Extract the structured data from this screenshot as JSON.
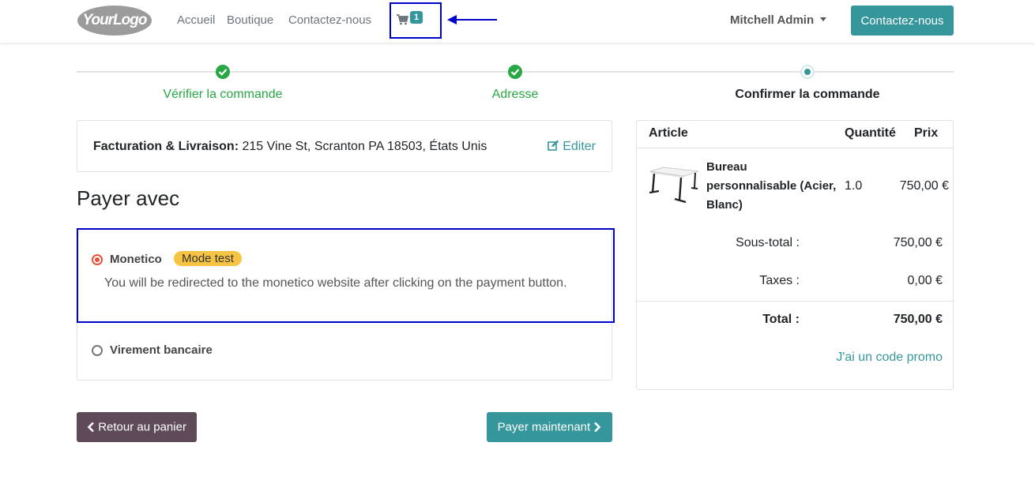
{
  "navbar": {
    "logo_text": "YourLogo",
    "links": [
      "Accueil",
      "Boutique",
      "Contactez-nous"
    ],
    "cart_count": "1",
    "user_name": "Mitchell Admin",
    "contact_button": "Contactez-nous"
  },
  "steps": [
    {
      "label": "Vérifier la commande",
      "state": "done"
    },
    {
      "label": "Adresse",
      "state": "done"
    },
    {
      "label": "Confirmer la commande",
      "state": "current"
    }
  ],
  "address": {
    "label": "Facturation & Livraison:",
    "value": "215 Vine St, Scranton PA 18503, États Unis",
    "edit_label": "Editer"
  },
  "payment": {
    "title": "Payer avec",
    "options": [
      {
        "name": "Monetico",
        "badge": "Mode test",
        "description": "You will be redirected to the monetico website after clicking on the payment button.",
        "selected": true
      },
      {
        "name": "Virement bancaire",
        "selected": false
      }
    ]
  },
  "actions": {
    "back_label": "Retour au panier",
    "pay_label": "Payer maintenant"
  },
  "summary": {
    "headers": {
      "article": "Article",
      "quantity": "Quantité",
      "price": "Prix"
    },
    "line": {
      "name": "Bureau personnalisable (Acier, Blanc)",
      "qty": "1.0",
      "price": "750,00 €"
    },
    "subtotal_label": "Sous-total :",
    "subtotal": "750,00 €",
    "taxes_label": "Taxes :",
    "taxes": "0,00 €",
    "total_label": "Total :",
    "total": "750,00 €",
    "promo_label": "J'ai un code promo"
  },
  "colors": {
    "accent": "#35979c",
    "success": "#28a745",
    "back_button": "#5e4a58",
    "badge_warning": "#f6c343",
    "highlight_border": "#0000cc"
  }
}
